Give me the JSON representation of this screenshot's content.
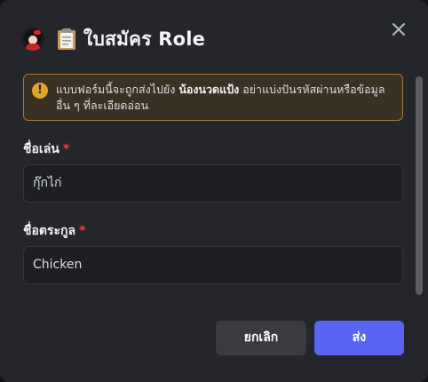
{
  "modal": {
    "title": "ใบสมัคร Role",
    "title_emoji": "📋",
    "close_icon": "close-icon",
    "avatar_icon": "app-avatar"
  },
  "notice": {
    "icon": "warning-icon",
    "icon_glyph": "!",
    "text_before": "แบบฟอร์มนี้จะถูกส่งไปยัง ",
    "text_bold": "น้องนวดแป้ง",
    "text_after": " อย่าแบ่งปันรหัสผ่านหรือข้อมูลอื่น ๆ ที่ละเอียดอ่อน",
    "accent": "#e0a42a"
  },
  "fields": [
    {
      "label": "ชื่อเล่น",
      "required_mark": "*",
      "value": "กุ๊กไก่"
    },
    {
      "label": "ชื่อตระกูล",
      "required_mark": "*",
      "value": "Chicken"
    }
  ],
  "buttons": {
    "cancel_label": "ยกเลิก",
    "submit_label": "ส่ง",
    "submit_color": "#5865f2"
  }
}
